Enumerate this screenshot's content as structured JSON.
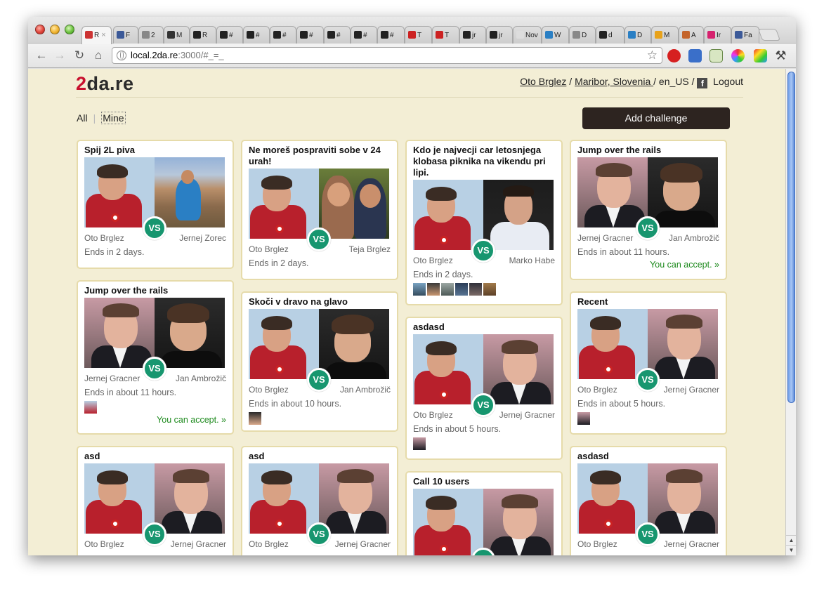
{
  "browser": {
    "active_tab_label": "R",
    "tabs": [
      {
        "label": "R",
        "color": "#cc3333"
      },
      {
        "label": "F",
        "color": "#3b5998"
      },
      {
        "label": "2",
        "color": "#888888"
      },
      {
        "label": "M",
        "color": "#333333"
      },
      {
        "label": "R",
        "color": "#222222"
      },
      {
        "label": "#",
        "color": "#222222"
      },
      {
        "label": "#",
        "color": "#222222"
      },
      {
        "label": "#",
        "color": "#222222"
      },
      {
        "label": "#",
        "color": "#222222"
      },
      {
        "label": "#",
        "color": "#222222"
      },
      {
        "label": "#",
        "color": "#222222"
      },
      {
        "label": "#",
        "color": "#222222"
      },
      {
        "label": "T",
        "color": "#cc2222"
      },
      {
        "label": "T",
        "color": "#cc2222"
      },
      {
        "label": "jr",
        "color": "#222222"
      },
      {
        "label": "jr",
        "color": "#222222"
      },
      {
        "label": "Nov",
        "color": "#dddddd"
      },
      {
        "label": "W",
        "color": "#2a7fc4"
      },
      {
        "label": "D",
        "color": "#888888"
      },
      {
        "label": "d",
        "color": "#222222"
      },
      {
        "label": "D",
        "color": "#2a7fc4"
      },
      {
        "label": "M",
        "color": "#e8a21a"
      },
      {
        "label": "A",
        "color": "#c4642a"
      },
      {
        "label": "Ir",
        "color": "#d6226e"
      },
      {
        "label": "Fa",
        "color": "#3b5998"
      }
    ],
    "url_host": "local.2da.re",
    "url_rest": ":3000/#_=_"
  },
  "site": {
    "logo_two": "2",
    "logo_rest": "da.re",
    "user_name": "Oto Brglez",
    "location": "Maribor, Slovenia ",
    "locale": "en_US",
    "separator": " / ",
    "logout": "Logout",
    "fb_glyph": "f",
    "filter_all": "All",
    "filter_sep": "|",
    "filter_mine": "Mine",
    "add_challenge": "Add challenge",
    "vs": "VS"
  },
  "cards": [
    {
      "title": "Spij 2L piva",
      "left": "Oto Brglez",
      "right": "Jernej Zorec",
      "ends": "Ends in 2 days."
    },
    {
      "title": "Jump over the rails",
      "left": "Jernej Gracner",
      "right": "Jan Ambrožič",
      "ends": "Ends in about 11 hours.",
      "accept": "You can accept. »"
    },
    {
      "title": "asd",
      "left": "Oto Brglez",
      "right": "Jernej Gracner"
    },
    {
      "title": "Ne moreš pospraviti sobe v 24 urah!",
      "left": "Oto Brglez",
      "right": "Teja Brglez",
      "ends": "Ends in 2 days."
    },
    {
      "title": "Skoči v dravo na glavo",
      "left": "Oto Brglez",
      "right": "Jan Ambrožič",
      "ends": "Ends in about 10 hours."
    },
    {
      "title": "asd",
      "left": "Oto Brglez",
      "right": "Jernej Gracner"
    },
    {
      "title": "Kdo je najvecji car letosnjega klobasa piknika na vikendu pri lipi.",
      "left": "Oto Brglez",
      "right": "Marko Habe",
      "ends": "Ends in 2 days."
    },
    {
      "title": "asdasd",
      "left": "Oto Brglez",
      "right": "Jernej Gracner",
      "ends": "Ends in about 5 hours."
    },
    {
      "title": "Call 10 users"
    },
    {
      "title": "Jump over the rails",
      "left": "Jernej Gracner",
      "right": "Jan Ambrožič",
      "ends": "Ends in about 11 hours.",
      "accept": "You can accept. »"
    },
    {
      "title": "Recent",
      "left": "Oto Brglez",
      "right": "Jernej Gracner",
      "ends": "Ends in about 5 hours."
    },
    {
      "title": "asdasd",
      "left": "Oto Brglez",
      "right": "Jernej Gracner"
    }
  ]
}
